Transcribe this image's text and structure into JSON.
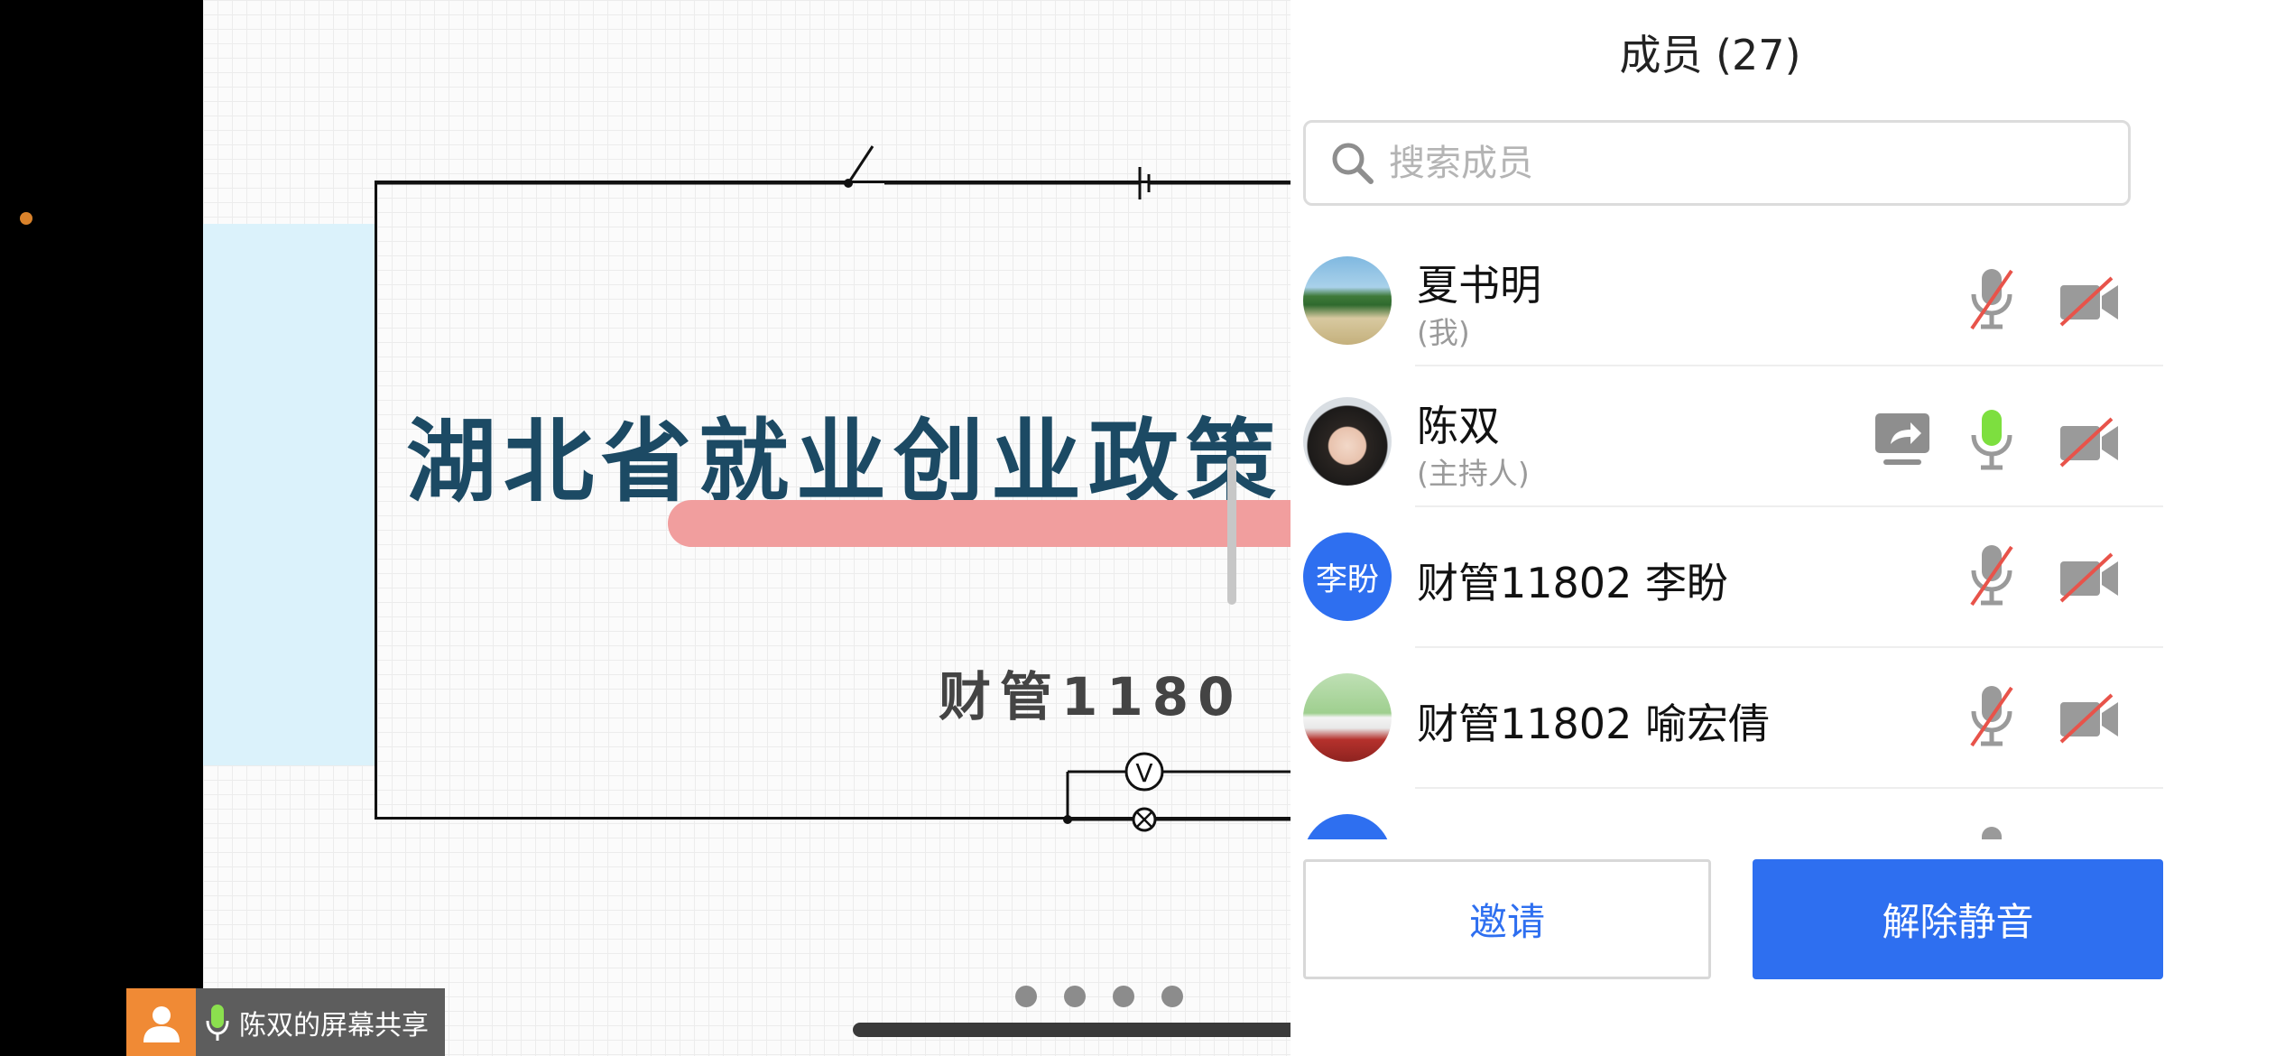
{
  "shared_screen": {
    "slide_title": "湖北省就业创业政策",
    "slide_subtitle": "财管1180",
    "meter_labels": [
      "V",
      "⊗"
    ],
    "page_count": 4
  },
  "share_indicator": {
    "label": "陈双的屏幕共享",
    "avatar_icon": "person-icon",
    "mic_icon": "mic-on-icon"
  },
  "panel": {
    "title": "成员 (27)",
    "search": {
      "placeholder": "搜索成员",
      "value": ""
    },
    "members": [
      {
        "name": "夏书明",
        "sub": "(我)",
        "avatar": "beach-photo",
        "mic": "muted",
        "camera": "off",
        "sharing": false
      },
      {
        "name": "陈双",
        "sub": "(主持人)",
        "avatar": "portrait-photo",
        "mic": "active",
        "camera": "off",
        "sharing": true
      },
      {
        "name": "财管11802 李盼",
        "sub": "",
        "avatar_text": "李盼",
        "avatar_color": "#2e6ff0",
        "mic": "muted",
        "camera": "off",
        "sharing": false
      },
      {
        "name": "财管11802 喻宏倩",
        "sub": "",
        "avatar": "anime-photo",
        "mic": "muted",
        "camera": "off",
        "sharing": false
      }
    ],
    "invite_label": "邀请",
    "unmute_label": "解除静音"
  },
  "colors": {
    "accent": "#2e6ff0",
    "muted_red": "#e8534a",
    "active_green": "#7ddf3f",
    "slide_title": "#1c4a64",
    "pink_bar": "#f19e9e"
  }
}
